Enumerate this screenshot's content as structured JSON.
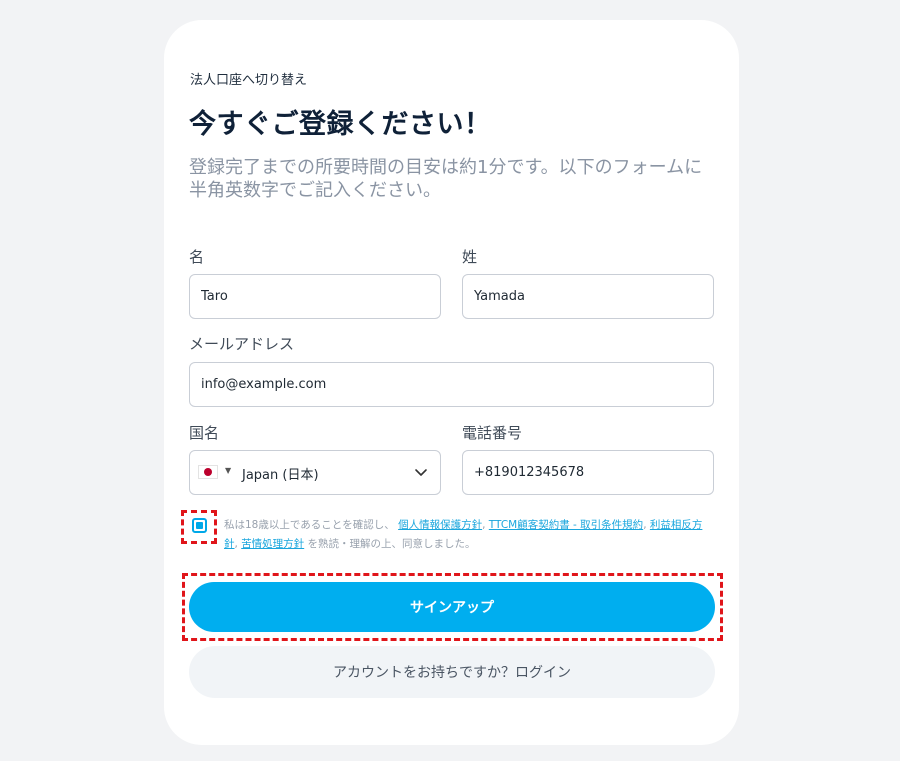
{
  "header": {
    "corporate_switch_link": "法人口座へ切り替え",
    "title": "今すぐご登録ください！",
    "subtitle": "登録完了までの所要時間の目安は約1分です。以下のフォームに半角英数字でご記入ください。"
  },
  "form": {
    "first_name": {
      "label": "名",
      "value": "Taro"
    },
    "last_name": {
      "label": "姓",
      "value": "Yamada"
    },
    "email": {
      "label": "メールアドレス",
      "value": "info@example.com"
    },
    "country": {
      "label": "国名",
      "value": "Japan (日本)",
      "flag_icon": "japan-flag-icon"
    },
    "phone": {
      "label": "電話番号",
      "value": "+819012345678"
    }
  },
  "consent": {
    "checked": true,
    "text_before": "私は18歳以上であることを確認し、",
    "link_privacy": "個人情報保護方針",
    "separator1": ", ",
    "link_terms": "TTCM顧客契約書 - 取引条件規約",
    "separator2": ", ",
    "link_conflict": "利益相反方針",
    "separator3": ", ",
    "link_complaints": "苦情処理方針",
    "text_after": " を熟読・理解の上、同意しました。"
  },
  "buttons": {
    "signup_label": "サインアップ",
    "login_label": "アカウントをお持ちですか？ログイン"
  },
  "colors": {
    "accent": "#00aeef",
    "highlight": "#e0151a",
    "link": "#1aa6dd"
  }
}
